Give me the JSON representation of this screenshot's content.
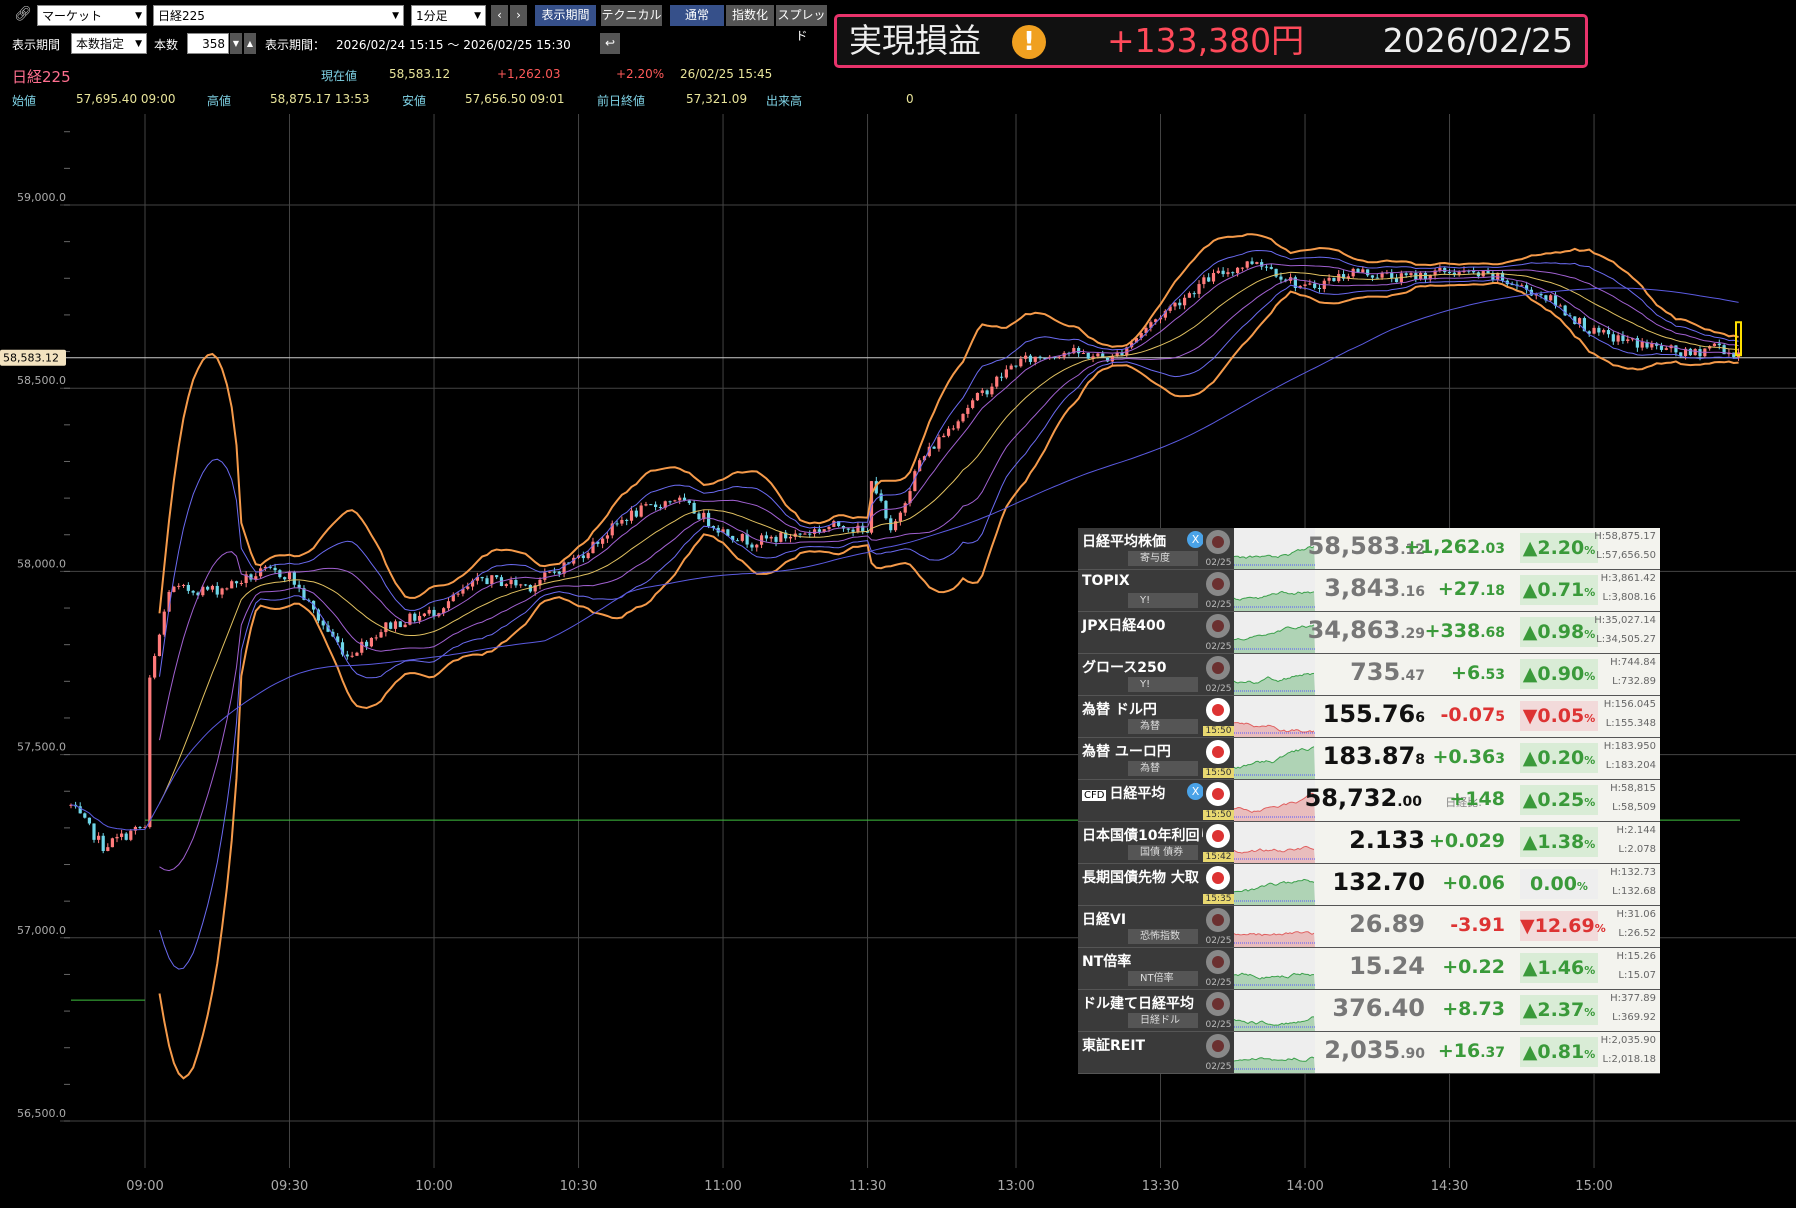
{
  "toolbar": {
    "market": "マーケット",
    "symbol": "日経225",
    "interval": "1分足",
    "prev": "‹",
    "next": "›",
    "period_btn": "表示期間",
    "technical": "テクニカル",
    "normal": "通常",
    "indexed": "指数化",
    "spread": "スプレッド"
  },
  "range": {
    "label": "表示期間",
    "mode": "本数指定",
    "count_label": "本数",
    "count": "358",
    "period_label": "表示期間：",
    "period": "2026/02/24 15:15 ～ 2026/02/25 15:30"
  },
  "quote": {
    "name": "日経225",
    "cur_label": "現在値",
    "cur": "58,583.12",
    "chg": "+1,262.03",
    "pct": "+2.20%",
    "time": "26/02/25 15:45",
    "open_label": "始値",
    "open": "57,695.40 09:00",
    "high_label": "高値",
    "high": "58,875.17 13:53",
    "low_label": "安値",
    "low": "57,656.50 09:01",
    "prev_label": "前日終値",
    "prev": "57,321.09",
    "vol_label": "出来高",
    "vol": "0"
  },
  "pnl": {
    "label": "実現損益",
    "amount": "+133,380円",
    "date": "2026/02/25",
    "amount_color": "#ff4a5a"
  },
  "chart_data": {
    "type": "candlestick",
    "yticks": [
      "59,000.0",
      "58,500.0",
      "58,000.0",
      "57,500.0",
      "57,000.0",
      "56,500.0"
    ],
    "ylim": [
      56450,
      59300
    ],
    "xticks": [
      "09:00",
      "09:30",
      "10:00",
      "10:30",
      "11:00",
      "11:30",
      "13:00",
      "13:30",
      "14:00",
      "14:30",
      "15:00"
    ],
    "current_price_label": "58,583.12",
    "current_price": 58583.12,
    "prev_close": 57321.09,
    "price_path": [
      [
        "P15:15",
        57360
      ],
      [
        "P15:22",
        57250
      ],
      [
        "P15:30",
        57300
      ],
      [
        "09:00",
        57300
      ],
      [
        "09:01",
        57700
      ],
      [
        "09:05",
        57950
      ],
      [
        "09:15",
        57950
      ],
      [
        "09:25",
        58000
      ],
      [
        "09:30",
        57990
      ],
      [
        "09:36",
        57870
      ],
      [
        "09:42",
        57770
      ],
      [
        "09:50",
        57850
      ],
      [
        "10:00",
        57890
      ],
      [
        "10:10",
        57980
      ],
      [
        "10:20",
        57960
      ],
      [
        "10:30",
        58040
      ],
      [
        "10:40",
        58150
      ],
      [
        "10:50",
        58200
      ],
      [
        "11:00",
        58110
      ],
      [
        "11:06",
        58080
      ],
      [
        "11:15",
        58100
      ],
      [
        "11:25",
        58130
      ],
      [
        "11:30",
        58100
      ],
      [
        "12:30",
        58260
      ],
      [
        "12:34",
        58100
      ],
      [
        "12:40",
        58300
      ],
      [
        "12:50",
        58450
      ],
      [
        "13:00",
        58570
      ],
      [
        "13:10",
        58600
      ],
      [
        "13:20",
        58580
      ],
      [
        "13:30",
        58700
      ],
      [
        "13:40",
        58800
      ],
      [
        "13:50",
        58850
      ],
      [
        "14:00",
        58770
      ],
      [
        "14:10",
        58820
      ],
      [
        "14:20",
        58800
      ],
      [
        "14:30",
        58820
      ],
      [
        "14:40",
        58800
      ],
      [
        "14:50",
        58750
      ],
      [
        "15:00",
        58650
      ],
      [
        "15:10",
        58620
      ],
      [
        "15:20",
        58590
      ],
      [
        "15:25",
        58620
      ],
      [
        "15:30",
        58583
      ]
    ],
    "up_color": "#ff7b7b",
    "down_color": "#6fd6e8",
    "bands": "bollinger ±1σ/±2σ/±3σ",
    "grid": true
  },
  "board": [
    {
      "name": "日経平均株価",
      "x": true,
      "sub": "寄与度",
      "time": "02/25",
      "live": false,
      "price": "58,583",
      "price_s": ".12",
      "chg": "+1,262",
      "chg_s": ".03",
      "pct": "▲2.20",
      "pct_s": "%",
      "h": "H:58,875.17",
      "l": "L:57,656.50",
      "dir": "up"
    },
    {
      "name": "TOPIX",
      "sub": "Y!",
      "time": "02/25",
      "live": false,
      "price": "3,843",
      "price_s": ".16",
      "chg": "+27",
      "chg_s": ".18",
      "pct": "▲0.71",
      "pct_s": "%",
      "h": "H:3,861.42",
      "l": "L:3,808.16",
      "dir": "up"
    },
    {
      "name": "JPX日経400",
      "time": "02/25",
      "live": false,
      "price": "34,863",
      "price_s": ".29",
      "chg": "+338",
      "chg_s": ".68",
      "pct": "▲0.98",
      "pct_s": "%",
      "h": "H:35,027.14",
      "l": "L:34,505.27",
      "dir": "up"
    },
    {
      "name": "グロース250",
      "sub": "Y!",
      "time": "02/25",
      "live": false,
      "price": "735",
      "price_s": ".47",
      "chg": "+6",
      "chg_s": ".53",
      "pct": "▲0.90",
      "pct_s": "%",
      "h": "H:744.84",
      "l": "L:732.89",
      "dir": "up"
    },
    {
      "name": "為替 ドル円",
      "sub": "為替",
      "time": "15:50",
      "live": true,
      "dark": true,
      "price": "155.76",
      "price_s": "6",
      "chg": "-0.07",
      "chg_s": "5",
      "pct": "▼0.05",
      "pct_s": "%",
      "h": "H:156.045",
      "l": "L:155.348",
      "dir": "dn"
    },
    {
      "name": "為替 ユーロ円",
      "sub": "為替",
      "time": "15:50",
      "live": true,
      "dark": true,
      "price": "183.87",
      "price_s": "8",
      "chg": "+0.36",
      "chg_s": "3",
      "pct": "▲0.20",
      "pct_s": "%",
      "h": "H:183.950",
      "l": "L:183.204",
      "dir": "up"
    },
    {
      "name": "日経平均",
      "cfd": "CFD",
      "x": true,
      "time": "15:50",
      "live": true,
      "dark": true,
      "price": "58,732",
      "price_s": ".00",
      "ratio_label": "日経比:",
      "chg": "+148",
      "chg_s": "",
      "pct": "▲0.25",
      "pct_s": "%",
      "h": "H:58,815",
      "l": "L:58,509",
      "dir": "up"
    },
    {
      "name": "日本国債10年利回り",
      "sub": "国債 債券",
      "time": "15:42",
      "live": true,
      "dark": true,
      "price": "2.133",
      "price_s": "",
      "chg": "+0.029",
      "chg_s": "",
      "pct": "▲1.38",
      "pct_s": "%",
      "h": "H:2.144",
      "l": "L:2.078",
      "dir": "up"
    },
    {
      "name": "長期国債先物 大取",
      "time": "15:35",
      "live": true,
      "dark": true,
      "price": "132.70",
      "price_s": "",
      "chg": "+0.06",
      "chg_s": "",
      "pct": "0.00",
      "pct_s": "%",
      "h": "H:132.73",
      "l": "L:132.68",
      "dir": "flat"
    },
    {
      "name": "日経VI",
      "sub": "恐怖指数",
      "time": "02/25",
      "live": false,
      "price": "26.89",
      "price_s": "",
      "chg": "-3.91",
      "chg_s": "",
      "pct": "▼12.69",
      "pct_s": "%",
      "h": "H:31.06",
      "l": "L:26.52",
      "dir": "dn"
    },
    {
      "name": "NT倍率",
      "sub": "NT倍率",
      "time": "02/25",
      "live": false,
      "price": "15.24",
      "price_s": "",
      "chg": "+0.22",
      "chg_s": "",
      "pct": "▲1.46",
      "pct_s": "%",
      "h": "H:15.26",
      "l": "L:15.07",
      "dir": "up"
    },
    {
      "name": "ドル建て日経平均",
      "sub": "日経ドル",
      "time": "02/25",
      "live": false,
      "price": "376.40",
      "price_s": "",
      "chg": "+8.73",
      "chg_s": "",
      "pct": "▲2.37",
      "pct_s": "%",
      "h": "H:377.89",
      "l": "L:369.92",
      "dir": "up"
    },
    {
      "name": "東証REIT",
      "time": "02/25",
      "live": false,
      "price": "2,035",
      "price_s": ".90",
      "chg": "+16",
      "chg_s": ".37",
      "pct": "▲0.81",
      "pct_s": "%",
      "h": "H:2,035.90",
      "l": "L:2,018.18",
      "dir": "up"
    }
  ]
}
